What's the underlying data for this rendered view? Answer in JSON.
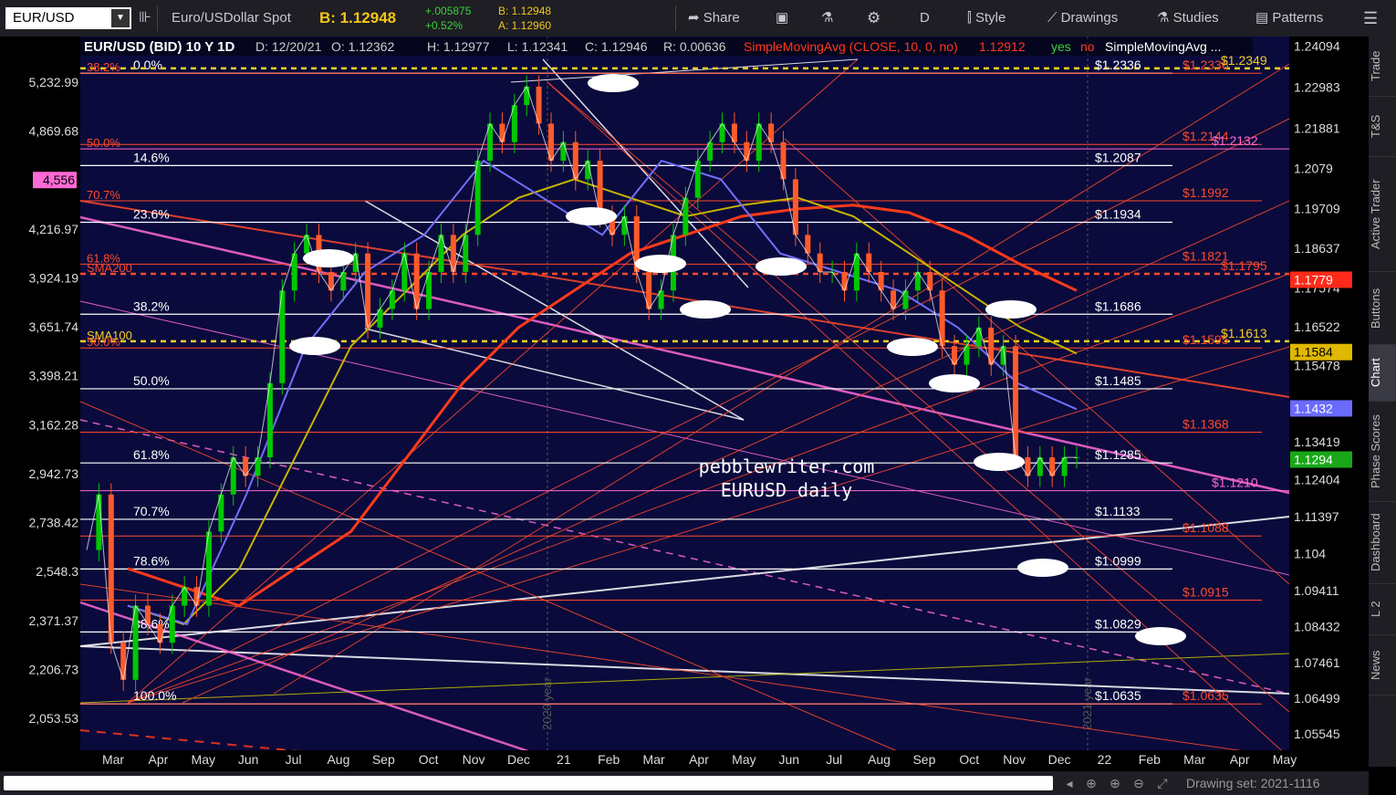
{
  "toolbar": {
    "symbol": "EUR/USD",
    "description": "Euro/USDollar Spot",
    "bid_label": "B: 1.12948",
    "change": "+.005875",
    "change_pct": "+0.52%",
    "bid_small": "B: 1.12948",
    "ask_small": "A: 1.12960",
    "share": "Share",
    "period": "D",
    "style": "Style",
    "drawings": "Drawings",
    "studies": "Studies",
    "patterns": "Patterns"
  },
  "header": {
    "title": "EUR/USD (BID) 10 Y 1D",
    "date": "D: 12/20/21",
    "open": "O: 1.12362",
    "high": "H: 1.12977",
    "low": "L: 1.12341",
    "close": "C: 1.12946",
    "range": "R: 0.00636",
    "sma": "SimpleMovingAvg (CLOSE, 10, 0, no)",
    "sma_val": "1.12912",
    "yes": "yes",
    "no": "no",
    "sma2": "SimpleMovingAvg ..."
  },
  "right_tabs": [
    "Trade",
    "T&S",
    "Active Trader",
    "Buttons",
    "Chart",
    "Phase Scores",
    "Dashboard",
    "L 2",
    "News"
  ],
  "bottom": {
    "drawing_set": "Drawing set: 2021-1116"
  },
  "colors": {
    "bg": "#0a0a3c",
    "price_up": "#00c800",
    "price_down": "#ff5a2a",
    "fib_white": "#ffffff",
    "fib_red": "#ff4a2a",
    "magenta": "#ff6ad5",
    "sma200": "#ff3a1a",
    "sma100": "#c8b400",
    "blue_ma": "#7070ff"
  },
  "chart_data": {
    "type": "line",
    "watermark": [
      "pebblewriter.com",
      "EURUSD daily"
    ],
    "x_ticks": [
      "Mar",
      "Apr",
      "May",
      "Jun",
      "Jul",
      "Aug",
      "Sep",
      "Oct",
      "Nov",
      "Dec",
      "21",
      "Feb",
      "Mar",
      "Apr",
      "May",
      "Jun",
      "Jul",
      "Aug",
      "Sep",
      "Oct",
      "Nov",
      "Dec",
      "22",
      "Feb",
      "Mar",
      "Apr",
      "May"
    ],
    "year_labels": [
      "2020 year",
      "2021 year"
    ],
    "y_right_ticks": [
      1.24094,
      1.22983,
      1.21881,
      1.2079,
      1.19709,
      1.18637,
      1.17574,
      1.16522,
      1.15478,
      1.13419,
      1.12404,
      1.11397,
      1.104,
      1.09411,
      1.08432,
      1.07461,
      1.06499,
      1.05545
    ],
    "y_left_ticks": [
      "5,232.99",
      "4,869.68",
      "4,556",
      "4,216.97",
      "3,924.19",
      "3,651.74",
      "3,398.21",
      "3,162.28",
      "2,942.73",
      "2,738.42",
      "2,548.3",
      "2,371.37",
      "2,206.73",
      "2,053.53"
    ],
    "left_highlight": "4,556",
    "y_range": [
      1.051,
      1.2435
    ],
    "fib_left_labels": [
      {
        "label": "0.0%",
        "v": 1.2336
      },
      {
        "label": "14.6%",
        "v": 1.2087
      },
      {
        "label": "23.6%",
        "v": 1.1934
      },
      {
        "label": "38.2%",
        "v": 1.1686
      },
      {
        "label": "50.0%",
        "v": 1.1485
      },
      {
        "label": "61.8%",
        "v": 1.1285
      },
      {
        "label": "70.7%",
        "v": 1.1133
      },
      {
        "label": "78.6%",
        "v": 1.0999
      },
      {
        "label": "88.6%",
        "v": 1.0829
      },
      {
        "label": "100.0%",
        "v": 1.0635
      }
    ],
    "fib_right_white": [
      {
        "label": "$1.2336",
        "v": 1.2336
      },
      {
        "label": "$1.2087",
        "v": 1.2087
      },
      {
        "label": "$1.1934",
        "v": 1.1934
      },
      {
        "label": "$1.1686",
        "v": 1.1686
      },
      {
        "label": "$1.1485",
        "v": 1.1485
      },
      {
        "label": "$1.1285",
        "v": 1.1285
      },
      {
        "label": "$1.1133",
        "v": 1.1133
      },
      {
        "label": "$1.0999",
        "v": 1.0999
      },
      {
        "label": "$1.0829",
        "v": 1.0829
      },
      {
        "label": "$1.0635",
        "v": 1.0635
      }
    ],
    "fib_right_red": [
      {
        "label": "$1.2336",
        "v": 1.2336
      },
      {
        "label": "$1.2144",
        "v": 1.2144
      },
      {
        "label": "$1.1992",
        "v": 1.1992
      },
      {
        "label": "$1.1821",
        "v": 1.1821
      },
      {
        "label": "$1.1595",
        "v": 1.1595
      },
      {
        "label": "$1.1368",
        "v": 1.1368
      },
      {
        "label": "$1.1088",
        "v": 1.1088
      },
      {
        "label": "$1.0915",
        "v": 1.0915
      },
      {
        "label": "$1.0635",
        "v": 1.0635
      }
    ],
    "magenta_labels": [
      {
        "label": "$1.2132",
        "v": 1.2132
      },
      {
        "label": "$1.1210",
        "v": 1.121
      }
    ],
    "special_labels": [
      {
        "label": "$1.2349",
        "v": 1.2349,
        "color": "#f5d020"
      },
      {
        "label": "$1.1795",
        "v": 1.1795,
        "color": "#ff4a2a"
      },
      {
        "label": "$1.1613",
        "v": 1.1613,
        "color": "#f5d020"
      }
    ],
    "left_red_labels": [
      {
        "label": "38.2%",
        "v": 1.2336
      },
      {
        "label": "50.0%",
        "v": 1.2132
      },
      {
        "label": "70.7%",
        "v": 1.1992
      },
      {
        "label": "61.8%",
        "v": 1.1821
      },
      {
        "label": "SMA200",
        "v": 1.1795
      },
      {
        "label": "SMA100",
        "v": 1.1613
      },
      {
        "label": "50.0%",
        "v": 1.1595
      }
    ],
    "price_tags": [
      {
        "label": "1.1779",
        "v": 1.1779,
        "bg": "#ff2a1a",
        "fg": "#ffffff"
      },
      {
        "label": "1.1584",
        "v": 1.1584,
        "bg": "#e0b800",
        "fg": "#000000"
      },
      {
        "label": "1.1432",
        "v": 1.1432,
        "bg": "#6a6aff",
        "fg": "#ffffff"
      },
      {
        "label": "1.1294",
        "v": 1.1294,
        "bg": "#18a818",
        "fg": "#ffffff"
      }
    ],
    "close_series": {
      "x_start": "Mar 2020",
      "step": "weekly",
      "values": [
        1.105,
        1.12,
        1.08,
        1.07,
        1.09,
        1.085,
        1.08,
        1.09,
        1.095,
        1.09,
        1.11,
        1.12,
        1.13,
        1.125,
        1.13,
        1.15,
        1.175,
        1.185,
        1.19,
        1.18,
        1.175,
        1.18,
        1.185,
        1.165,
        1.17,
        1.175,
        1.185,
        1.17,
        1.18,
        1.19,
        1.18,
        1.19,
        1.21,
        1.22,
        1.215,
        1.225,
        1.23,
        1.22,
        1.21,
        1.215,
        1.205,
        1.21,
        1.195,
        1.19,
        1.195,
        1.18,
        1.17,
        1.175,
        1.19,
        1.2,
        1.21,
        1.215,
        1.22,
        1.215,
        1.21,
        1.22,
        1.215,
        1.205,
        1.19,
        1.185,
        1.18,
        1.18,
        1.175,
        1.185,
        1.18,
        1.175,
        1.17,
        1.175,
        1.18,
        1.175,
        1.16,
        1.155,
        1.16,
        1.165,
        1.155,
        1.16,
        1.13,
        1.125,
        1.13,
        1.125,
        1.13,
        1.13
      ]
    },
    "sma200_series": [
      1.1,
      1.095,
      1.09,
      1.1,
      1.11,
      1.13,
      1.15,
      1.165,
      1.175,
      1.185,
      1.19,
      1.195,
      1.197,
      1.198,
      1.196,
      1.19,
      1.182,
      1.175
    ],
    "sma100_series": [
      1.09,
      1.085,
      1.1,
      1.13,
      1.16,
      1.175,
      1.19,
      1.2,
      1.205,
      1.2,
      1.195,
      1.198,
      1.2,
      1.195,
      1.185,
      1.175,
      1.165,
      1.158
    ],
    "ma_blue_series": [
      1.09,
      1.085,
      1.12,
      1.16,
      1.18,
      1.19,
      1.21,
      1.2,
      1.19,
      1.21,
      1.205,
      1.185,
      1.18,
      1.175,
      1.165,
      1.15,
      1.143
    ]
  }
}
